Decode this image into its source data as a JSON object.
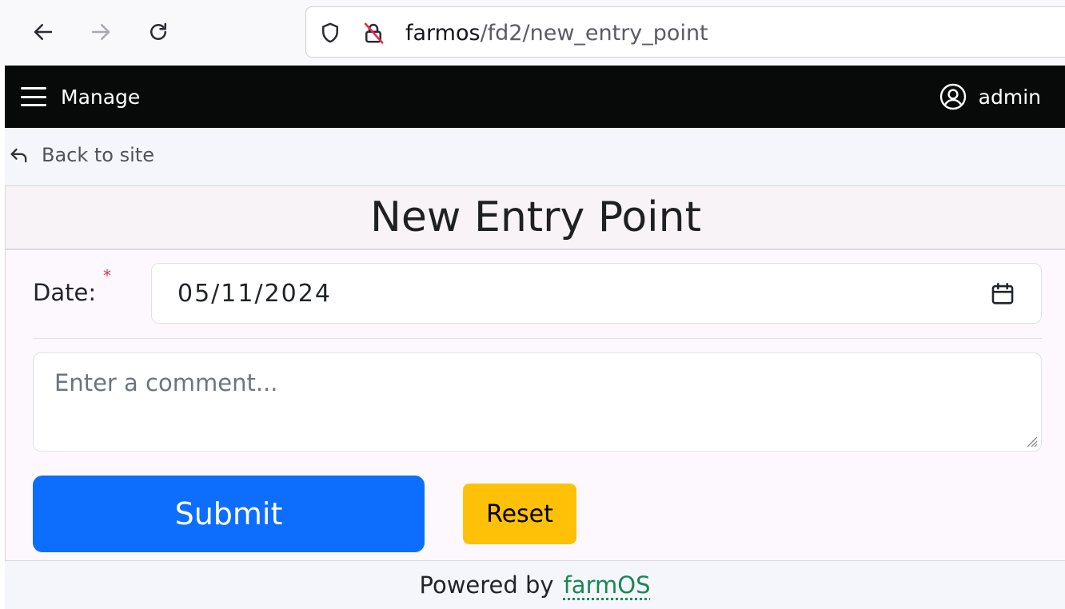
{
  "browser": {
    "url_host": "farmos",
    "url_path": "/fd2/new_entry_point"
  },
  "header": {
    "menu_label": "Manage",
    "user_label": "admin"
  },
  "toolbar": {
    "back_label": "Back to site"
  },
  "form": {
    "title": "New Entry Point",
    "date_label": "Date:",
    "required_marker": "*",
    "date_value": "05/11/2024",
    "comment_placeholder": "Enter a comment...",
    "submit_label": "Submit",
    "reset_label": "Reset"
  },
  "footer": {
    "prefix": "Powered by",
    "link_label": "farmOS"
  },
  "colors": {
    "header_bg": "#070a09",
    "submit": "#0d6efd",
    "reset": "#ffc107",
    "required": "#dc3545",
    "link": "#198754"
  }
}
